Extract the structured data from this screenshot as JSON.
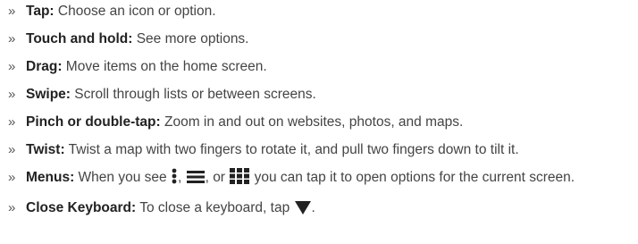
{
  "bullet_glyph": "»",
  "items": [
    {
      "term": "Tap:",
      "desc": " Choose an icon or option."
    },
    {
      "term": "Touch and hold:",
      "desc": " See more options."
    },
    {
      "term": "Drag:",
      "desc": " Move items on the home screen."
    },
    {
      "term": "Swipe:",
      "desc": " Scroll through lists or between screens."
    },
    {
      "term": "Pinch or double-tap:",
      "desc": " Zoom in and out on websites, photos, and maps."
    },
    {
      "term": "Twist:",
      "desc": " Twist a map with two fingers to rotate it, and pull two fingers down to tilt it."
    },
    {
      "term": "Menus:",
      "desc_a": " When you see ",
      "sep1": ", ",
      "sep2": ", or ",
      "desc_b": " you can tap it to open options for the current screen."
    },
    {
      "term": "Close Keyboard:",
      "desc_a": " To close a keyboard, tap ",
      "desc_b": "."
    }
  ],
  "icons": {
    "menu_icon_1": "vertical-dots-icon",
    "menu_icon_2": "hamburger-menu-icon",
    "menu_icon_3": "grid-menu-icon",
    "close_keyboard": "down-triangle-icon"
  },
  "colors": {
    "text": "#444444",
    "term": "#222222",
    "icon": "#222222"
  }
}
